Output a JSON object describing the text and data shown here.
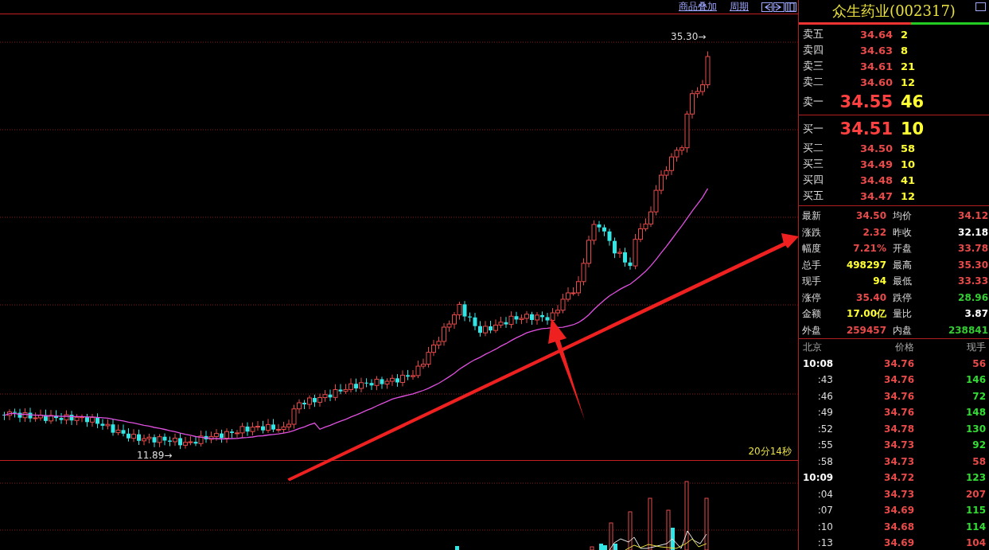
{
  "toolbar": {
    "links": [
      "商品叠加",
      "周期"
    ]
  },
  "chart": {
    "high_label": "35.30→",
    "low_label": "11.89→",
    "timer": "20分14秒"
  },
  "quote": {
    "title": "众生药业(002317)",
    "buy_sell_ratio": {
      "level": 0.59
    },
    "asks": [
      {
        "label": "卖五",
        "price": "34.64",
        "volume": "2",
        "kind": "normal"
      },
      {
        "label": "卖四",
        "price": "34.63",
        "volume": "8",
        "kind": "normal"
      },
      {
        "label": "卖三",
        "price": "34.61",
        "volume": "21",
        "kind": "normal"
      },
      {
        "label": "卖二",
        "price": "34.60",
        "volume": "12",
        "kind": "normal"
      },
      {
        "label": "卖一",
        "price": "34.55",
        "volume": "46",
        "kind": "best"
      }
    ],
    "bids": [
      {
        "label": "买一",
        "price": "34.51",
        "volume": "10",
        "kind": "best"
      },
      {
        "label": "买二",
        "price": "34.50",
        "volume": "58",
        "kind": "normal"
      },
      {
        "label": "买三",
        "price": "34.49",
        "volume": "10",
        "kind": "normal"
      },
      {
        "label": "买四",
        "price": "34.48",
        "volume": "41",
        "kind": "normal"
      },
      {
        "label": "买五",
        "price": "34.47",
        "volume": "12",
        "kind": "normal"
      }
    ],
    "stats": [
      {
        "label": "最新",
        "value": "34.50",
        "color": "#e84a4a"
      },
      {
        "label": "均价",
        "value": "34.12",
        "color": "#e84a4a"
      },
      {
        "label": "涨跌",
        "value": "2.32",
        "color": "#e84a4a"
      },
      {
        "label": "昨收",
        "value": "32.18",
        "color": "#ffffff"
      },
      {
        "label": "幅度",
        "value": "7.21%",
        "color": "#e84a4a"
      },
      {
        "label": "开盘",
        "value": "33.78",
        "color": "#e84a4a"
      },
      {
        "label": "总手",
        "value": "498297",
        "color": "#ffff33"
      },
      {
        "label": "最高",
        "value": "35.30",
        "color": "#e84a4a"
      },
      {
        "label": "现手",
        "value": "94",
        "color": "#ffff33"
      },
      {
        "label": "最低",
        "value": "33.33",
        "color": "#e84a4a"
      },
      {
        "label": "涨停",
        "value": "35.40",
        "color": "#e84a4a"
      },
      {
        "label": "跌停",
        "value": "28.96",
        "color": "#33cc33"
      },
      {
        "label": "金额",
        "value": "17.00亿",
        "color": "#ffff33"
      },
      {
        "label": "量比",
        "value": "3.87",
        "color": "#ffffff"
      },
      {
        "label": "外盘",
        "value": "259457",
        "color": "#e84a4a"
      },
      {
        "label": "内盘",
        "value": "238841",
        "color": "#33cc33"
      }
    ],
    "ticks": {
      "columns": [
        "北京",
        "价格",
        "现手"
      ],
      "rows": [
        {
          "time": "10:08",
          "kind": "minute",
          "price": "34.76",
          "volume": "56",
          "color": "#e84a4a"
        },
        {
          "time": ":43",
          "kind": "second",
          "price": "34.76",
          "volume": "146",
          "color": "#33dd33"
        },
        {
          "time": ":46",
          "kind": "second",
          "price": "34.76",
          "volume": "72",
          "color": "#33dd33"
        },
        {
          "time": ":49",
          "kind": "second",
          "price": "34.76",
          "volume": "148",
          "color": "#33dd33"
        },
        {
          "time": ":52",
          "kind": "second",
          "price": "34.78",
          "volume": "130",
          "color": "#33dd33"
        },
        {
          "time": ":55",
          "kind": "second",
          "price": "34.73",
          "volume": "92",
          "color": "#33dd33"
        },
        {
          "time": ":58",
          "kind": "second",
          "price": "34.73",
          "volume": "58",
          "color": "#e84a4a"
        },
        {
          "time": "10:09",
          "kind": "minute",
          "price": "34.72",
          "volume": "123",
          "color": "#33dd33"
        },
        {
          "time": ":04",
          "kind": "second",
          "price": "34.73",
          "volume": "207",
          "color": "#e84a4a"
        },
        {
          "time": ":07",
          "kind": "second",
          "price": "34.69",
          "volume": "115",
          "color": "#33dd33"
        },
        {
          "time": ":10",
          "kind": "second",
          "price": "34.68",
          "volume": "114",
          "color": "#33dd33"
        },
        {
          "time": ":13",
          "kind": "second",
          "price": "34.69",
          "volume": "104",
          "color": "#e84a4a"
        }
      ]
    }
  }
}
